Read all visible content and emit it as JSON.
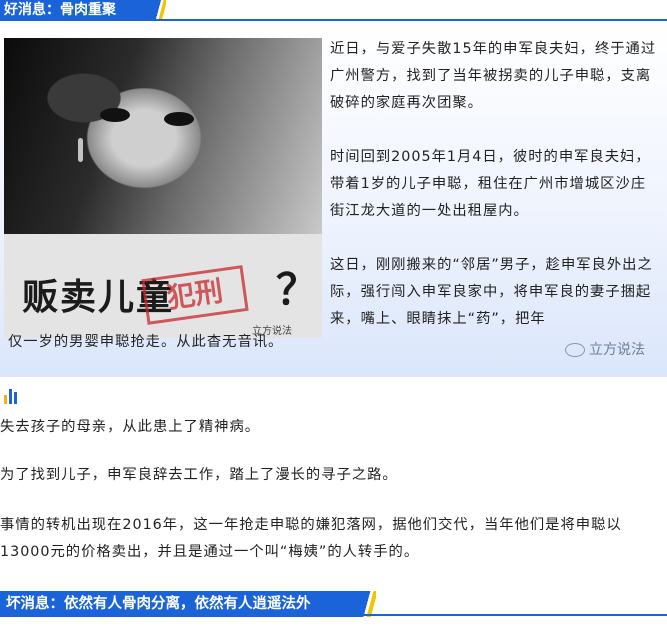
{
  "top_header": {
    "title": "好消息：骨肉重聚"
  },
  "image": {
    "caption_main": "贩卖儿童",
    "stamp": "犯刑",
    "question_mark": "？",
    "watermark": "立方说法"
  },
  "paragraphs_float": [
    "近日，与爱子失散15年的申军良夫妇，终于通过广州警方，找到了当年被拐卖的儿子申聪，支离破碎的家庭再次团聚。",
    "时间回到2005年1月4日，彼时的申军良夫妇，带着1岁的儿子申聪，租住在广州市增城区沙庄街江龙大道的一处出租屋内。",
    "这日，刚刚搬来的“邻居”男子，趁申军良外出之际，强行闯入申军良家中，将申军良的妻子捆起来，嘴上、眼睛抹上“药”，把年"
  ],
  "paragraph_continuation": "仅一岁的男婴申聪抢走。从此杳无音讯。",
  "card_watermark": "立方说法",
  "body_paragraphs": [
    "失去孩子的母亲，从此患上了精神病。",
    "为了找到儿子，申军良辞去工作，踏上了漫长的寻子之路。",
    "事情的转机出现在2016年，这一年抢走申聪的嫌犯落网，据他们交代，当年他们是将申聪以13000元的价格卖出，并且是通过一个叫“梅姨”的人转手的。"
  ],
  "bottom_header": {
    "title": "坏消息：依然有人骨肉分离，依然有人逍遥法外"
  },
  "colors": {
    "accent_blue": "#1a63d8",
    "accent_yellow": "#f5c400"
  }
}
